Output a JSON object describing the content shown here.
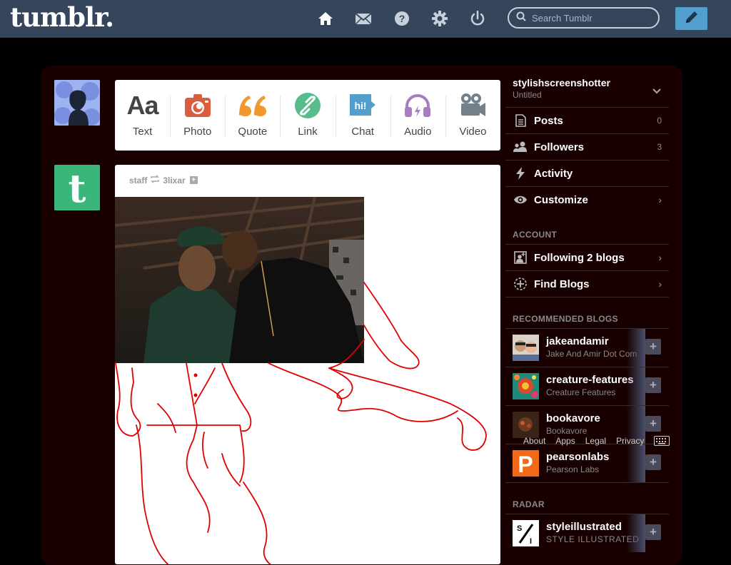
{
  "topbar": {
    "logo": "tumblr.",
    "search_placeholder": "Search Tumblr",
    "nav_icons": [
      "home-icon",
      "mail-icon",
      "help-icon",
      "gear-icon",
      "power-icon"
    ],
    "compose_icon": "pencil-icon"
  },
  "post_types": [
    {
      "label": "Text",
      "icon": "text-aa-icon",
      "color": "#444444"
    },
    {
      "label": "Photo",
      "icon": "camera-icon",
      "color": "#d95e40"
    },
    {
      "label": "Quote",
      "icon": "quote-icon",
      "color": "#f2992e"
    },
    {
      "label": "Link",
      "icon": "link-icon",
      "color": "#56bc8a"
    },
    {
      "label": "Chat",
      "icon": "chat-icon",
      "color": "#529ecc"
    },
    {
      "label": "Audio",
      "icon": "headphones-icon",
      "color": "#a77dc2"
    },
    {
      "label": "Video",
      "icon": "video-camera-icon",
      "color": "#748089"
    }
  ],
  "post": {
    "author": "staff",
    "reblogged_from": "3lixar"
  },
  "sidebar": {
    "blog_name": "stylishscreenshotter",
    "blog_subtitle": "Untitled",
    "menu": [
      {
        "label": "Posts",
        "count": "0",
        "icon": "posts-icon"
      },
      {
        "label": "Followers",
        "count": "3",
        "icon": "followers-icon"
      },
      {
        "label": "Activity",
        "count": "",
        "icon": "activity-icon"
      },
      {
        "label": "Customize",
        "count": "",
        "icon": "eye-icon"
      }
    ],
    "account_title": "ACCOUNT",
    "account_items": [
      {
        "label": "Following 2 blogs",
        "icon": "following-icon"
      },
      {
        "label": "Find Blogs",
        "icon": "find-blogs-icon"
      }
    ],
    "recommended_title": "RECOMMENDED BLOGS",
    "recommended": [
      {
        "name": "jakeandamir",
        "subtitle": "Jake And Amir Dot Com"
      },
      {
        "name": "creature-features",
        "subtitle": "Creature Features"
      },
      {
        "name": "bookavore",
        "subtitle": "Bookavore"
      },
      {
        "name": "pearsonlabs",
        "subtitle": "Pearson Labs"
      }
    ],
    "radar_title": "RADAR",
    "radar": {
      "name": "styleillustrated",
      "subtitle": "STYLE ILLUSTRATED"
    }
  },
  "footer": {
    "links": [
      "About",
      "Apps",
      "Legal",
      "Privacy"
    ]
  },
  "colors": {
    "topbar": "#35465c",
    "compose": "#529ecc",
    "dashboard_bg": "#180000",
    "drawing_line": "#e00000"
  }
}
